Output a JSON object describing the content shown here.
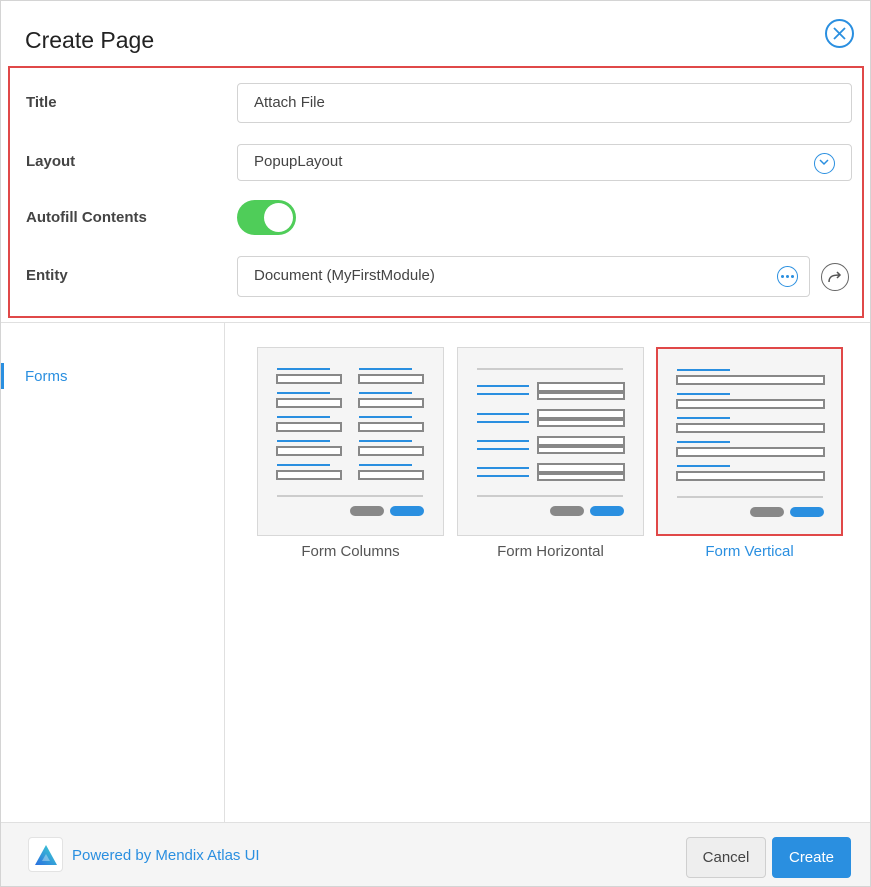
{
  "dialog": {
    "title": "Create Page",
    "close_icon": "close-circle-icon"
  },
  "properties": {
    "title_label": "Title",
    "title_value": "Attach File",
    "layout_label": "Layout",
    "layout_value": "PopupLayout",
    "autofill_label": "Autofill Contents",
    "autofill_on": true,
    "entity_label": "Entity",
    "entity_value": "Document (MyFirstModule)"
  },
  "sidebar": {
    "items": [
      {
        "label": "Forms",
        "active": true
      }
    ]
  },
  "templates": [
    {
      "label": "Form Columns",
      "selected": false
    },
    {
      "label": "Form Horizontal",
      "selected": false
    },
    {
      "label": "Form Vertical",
      "selected": true
    }
  ],
  "footer": {
    "powered_by": "Powered by Mendix Atlas UI",
    "cancel_label": "Cancel",
    "create_label": "Create"
  },
  "colors": {
    "accent": "#2a8fe0",
    "toggle_on": "#4fcd59",
    "highlight": "#e04848"
  }
}
